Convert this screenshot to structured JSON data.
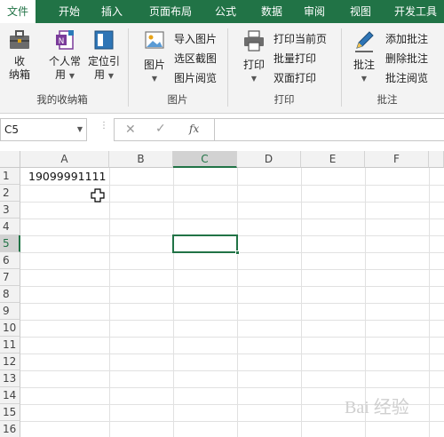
{
  "ribbon_tabs": [
    "文件",
    "开始",
    "插入",
    "页面布局",
    "公式",
    "数据",
    "审阅",
    "视图",
    "开发工具"
  ],
  "groups": {
    "collect": {
      "label": "我的收纳箱",
      "btn1": {
        "line1": "收",
        "line2": "纳箱"
      },
      "btn2": {
        "line1": "个人常",
        "line2": "用"
      },
      "btn3": {
        "line1": "定位引",
        "line2": "用"
      }
    },
    "picture": {
      "label": "图片",
      "big": "图片",
      "items": [
        "导入图片",
        "选区截图",
        "图片阅览"
      ]
    },
    "print": {
      "label": "打印",
      "big": "打印",
      "items": [
        "打印当前页",
        "批量打印",
        "双面打印"
      ]
    },
    "comment": {
      "label": "批注",
      "big": "批注",
      "items": [
        "添加批注",
        "删除批注",
        "批注阅览"
      ]
    }
  },
  "formula_bar": {
    "name_box": "C5",
    "fx": "fx",
    "cancel": "✕",
    "confirm": "✓",
    "value": ""
  },
  "columns": [
    "A",
    "B",
    "C",
    "D",
    "E",
    "F"
  ],
  "rows": [
    "1",
    "2",
    "3",
    "4",
    "5",
    "6",
    "7",
    "8",
    "9",
    "10",
    "11",
    "12",
    "13",
    "14",
    "15",
    "16"
  ],
  "cells": {
    "A1": "19099991111"
  },
  "selected_cell": "C5",
  "watermark": "Bai 经验",
  "colors": {
    "accent": "#217346",
    "ribbon_bg": "#f3f3f3"
  }
}
